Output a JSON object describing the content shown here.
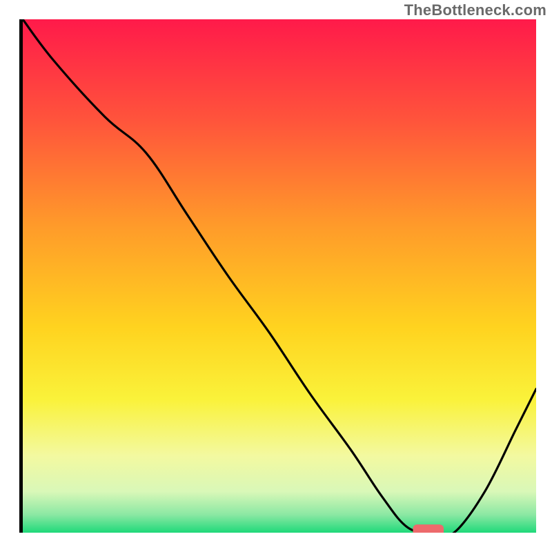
{
  "watermark": "TheBottleneck.com",
  "chart_data": {
    "type": "line",
    "title": "",
    "xlabel": "",
    "ylabel": "",
    "xlim": [
      0,
      100
    ],
    "ylim": [
      0,
      100
    ],
    "grid": false,
    "legend": false,
    "annotations": [],
    "x": [
      0,
      6,
      16,
      24,
      32,
      40,
      48,
      56,
      64,
      70,
      75,
      80,
      84,
      90,
      96,
      100
    ],
    "values": [
      100,
      92,
      81,
      74,
      62,
      50,
      39,
      27,
      16,
      7,
      1,
      0,
      0,
      8,
      20,
      28
    ],
    "marker": {
      "x": 79,
      "y": 0.5,
      "width": 6,
      "height": 2.2,
      "color": "#ed6a6c"
    }
  },
  "background_gradient": {
    "stops": [
      {
        "offset": 0.0,
        "color": "#ff1a4a"
      },
      {
        "offset": 0.2,
        "color": "#ff553b"
      },
      {
        "offset": 0.4,
        "color": "#ff9a2a"
      },
      {
        "offset": 0.6,
        "color": "#ffd31f"
      },
      {
        "offset": 0.74,
        "color": "#faf23a"
      },
      {
        "offset": 0.85,
        "color": "#f3f9a0"
      },
      {
        "offset": 0.92,
        "color": "#d9f8b8"
      },
      {
        "offset": 0.965,
        "color": "#8be8a3"
      },
      {
        "offset": 1.0,
        "color": "#1fd97a"
      }
    ]
  }
}
